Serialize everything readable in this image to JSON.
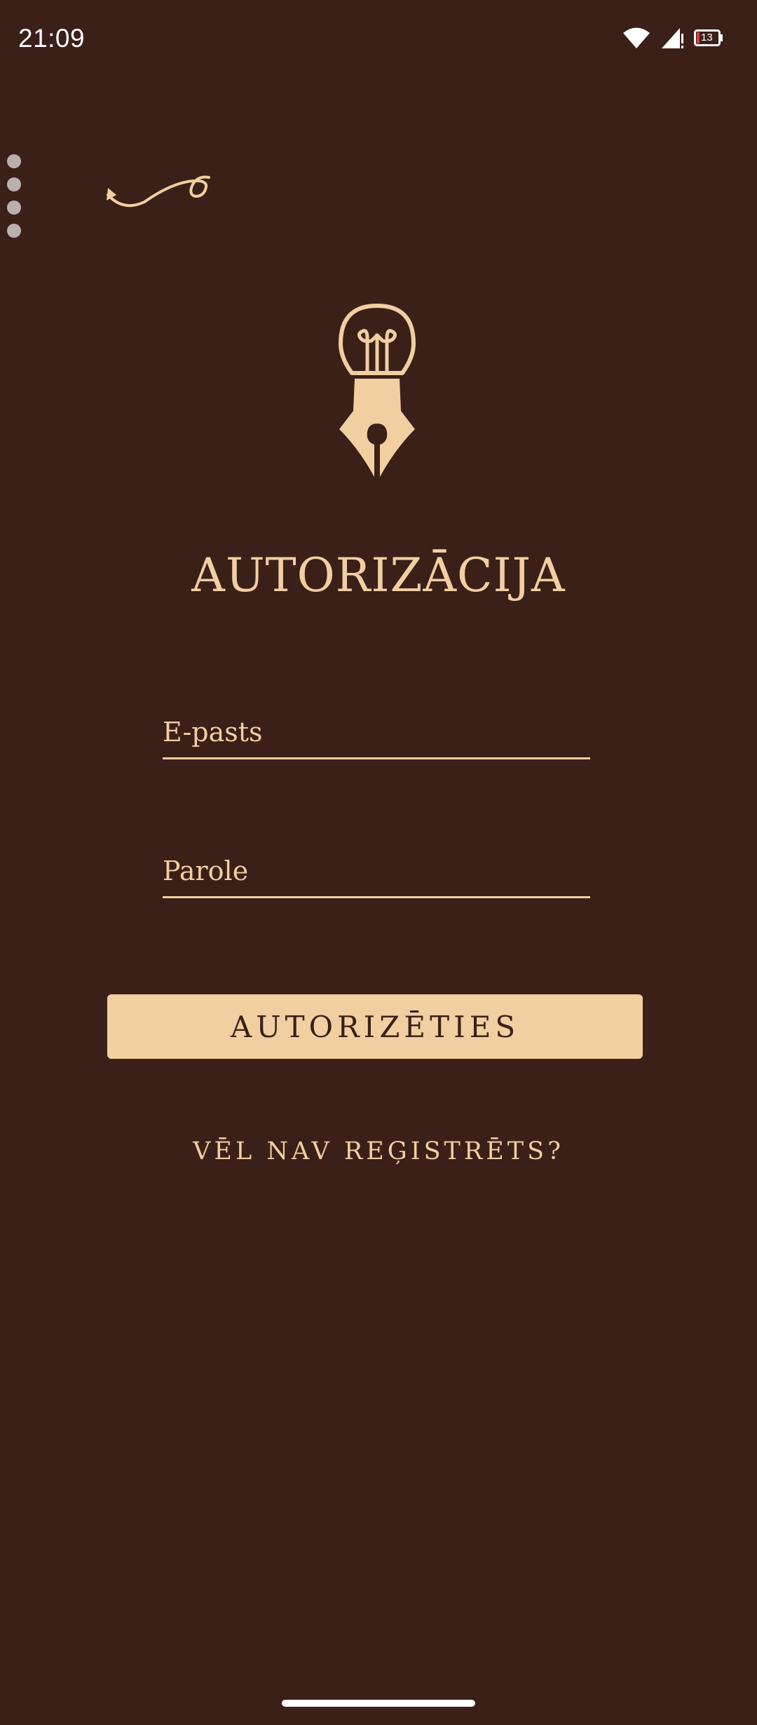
{
  "status_bar": {
    "time": "21:09",
    "battery_level": "13",
    "icons": [
      "wifi-icon",
      "signal-icon",
      "battery-icon"
    ]
  },
  "auth": {
    "title": "AUTORIZĀCIJA",
    "email_placeholder": "E-pasts",
    "password_placeholder": "Parole",
    "login_label": "AUTORIZĒTIES",
    "register_link": "VĒL NAV REĢISTRĒTS?"
  },
  "colors": {
    "background": "#3b2019",
    "accent": "#f1cfa1"
  }
}
